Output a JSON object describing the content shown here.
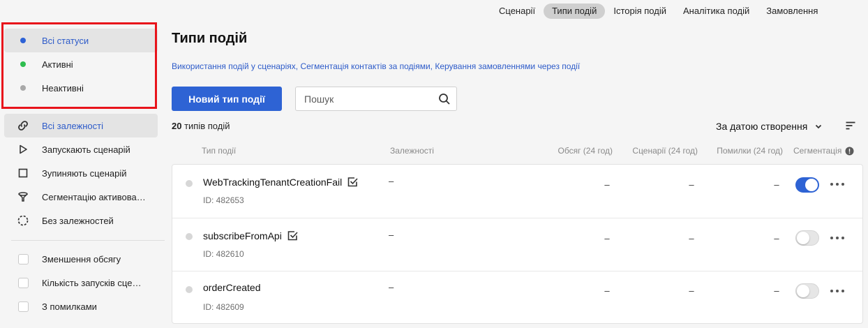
{
  "topnav": {
    "tabs": [
      {
        "label": "Сценарії",
        "active": false
      },
      {
        "label": "Типи подій",
        "active": true
      },
      {
        "label": "Історія подій",
        "active": false
      },
      {
        "label": "Аналітика подій",
        "active": false
      },
      {
        "label": "Замовлення",
        "active": false
      }
    ]
  },
  "sidebar": {
    "statuses": [
      {
        "label": "Всі статуси",
        "dot_color": "#2d62d6",
        "selected": true
      },
      {
        "label": "Активні",
        "dot_color": "#2ebd4f",
        "selected": false
      },
      {
        "label": "Неактивні",
        "dot_color": "#a8a8a8",
        "selected": false
      }
    ],
    "dependencies": [
      {
        "label": "Всі залежності",
        "icon": "link-icon",
        "selected": true
      },
      {
        "label": "Запускають сценарій",
        "icon": "play-icon",
        "selected": false
      },
      {
        "label": "Зупиняють сценарій",
        "icon": "stop-icon",
        "selected": false
      },
      {
        "label": "Сегментацію активова…",
        "icon": "filter-icon",
        "selected": false
      },
      {
        "label": "Без залежностей",
        "icon": "no-link-icon",
        "selected": false
      }
    ],
    "filters": [
      {
        "label": "Зменшення обсягу",
        "checked": false
      },
      {
        "label": "Кількість запусків сце…",
        "checked": false
      },
      {
        "label": "З помилками",
        "checked": false
      }
    ]
  },
  "main": {
    "title": "Типи подій",
    "help_links": [
      "Використання подій у сценаріях",
      "Сегментація контактів за подіями",
      "Керування замовленнями через події"
    ],
    "help_sep": ",",
    "new_button": "Новий тип події",
    "search_placeholder": "Пошук",
    "count_number": "20",
    "count_text": "типів подій",
    "sort_label": "За датою створення",
    "columns": {
      "type": "Тип події",
      "dependencies": "Залежності",
      "volume": "Обсяг (24 год)",
      "scenarios": "Сценарії (24 год)",
      "errors": "Помилки (24 год)",
      "segmentation": "Сегментація"
    },
    "rows": [
      {
        "name": "WebTrackingTenantCreationFail",
        "verified": true,
        "id": "ID: 482653",
        "dependencies": "–",
        "volume": "–",
        "scenarios": "–",
        "errors": "–",
        "segmentation": true
      },
      {
        "name": "subscribeFromApi",
        "verified": true,
        "id": "ID: 482610",
        "dependencies": "–",
        "volume": "–",
        "scenarios": "–",
        "errors": "–",
        "segmentation": false
      },
      {
        "name": "orderCreated",
        "verified": false,
        "id": "ID: 482609",
        "dependencies": "–",
        "volume": "–",
        "scenarios": "–",
        "errors": "–",
        "segmentation": false
      }
    ]
  }
}
